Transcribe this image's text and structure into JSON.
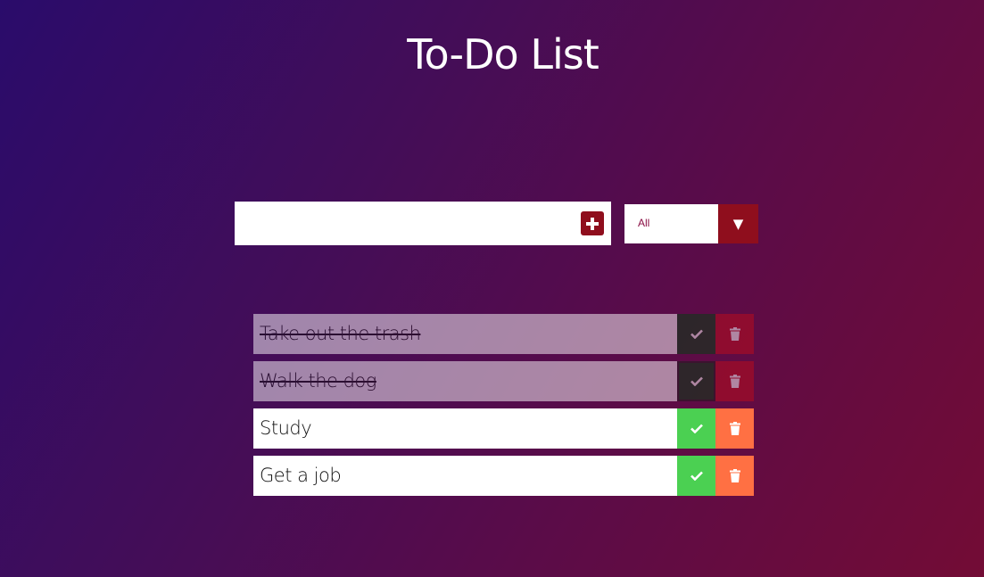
{
  "app": {
    "title": "To-Do List"
  },
  "add_form": {
    "input_value": "",
    "placeholder": "",
    "add_icon": "plus-square-icon"
  },
  "filter": {
    "selected": "All",
    "arrow_icon": "chevron-down-icon"
  },
  "todos": [
    {
      "text": "Take out the trash",
      "completed": true
    },
    {
      "text": "Walk the dog",
      "completed": true
    },
    {
      "text": "Study",
      "completed": false
    },
    {
      "text": "Get a job",
      "completed": false
    }
  ],
  "colors": {
    "accent": "#8f0e1d",
    "check": "#4bd052",
    "trash": "#ff7043",
    "bg_start": "#2a0c6b",
    "bg_end": "#730c35"
  }
}
